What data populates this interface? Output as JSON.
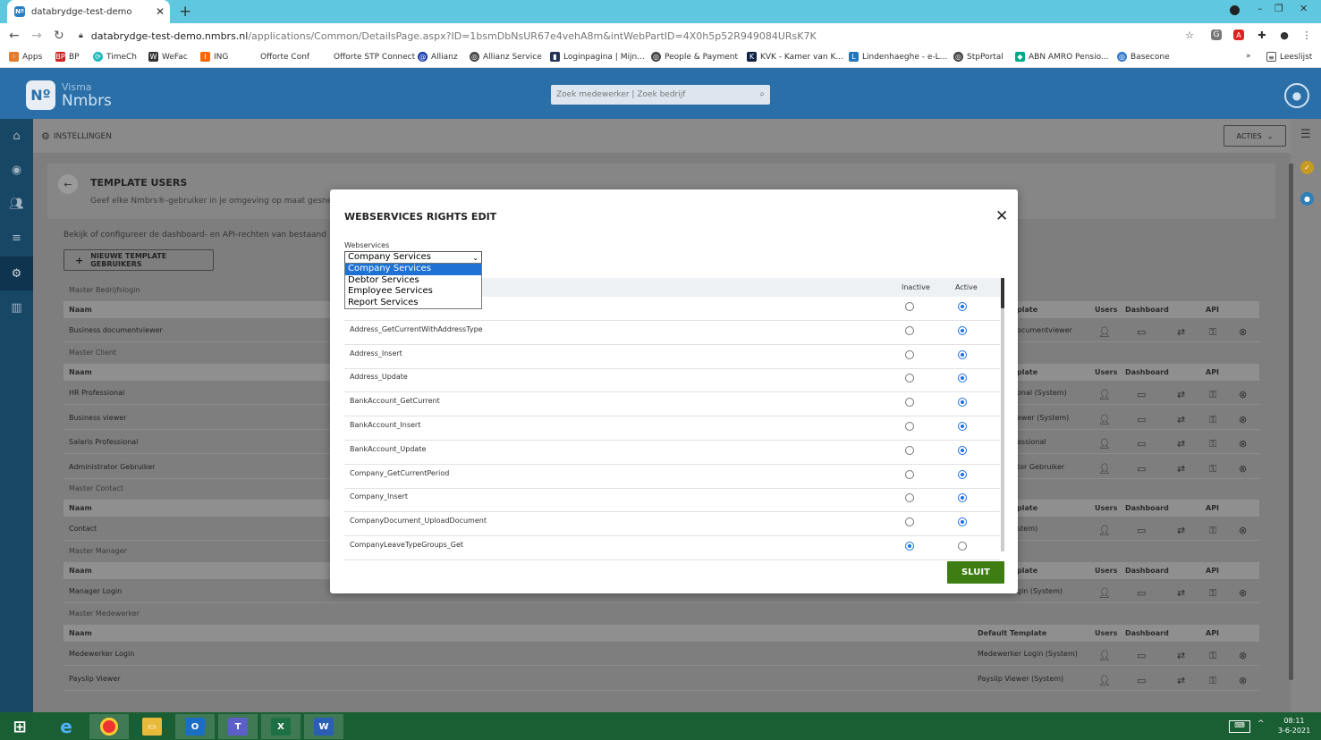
{
  "browser": {
    "tab_title": "databrydge-test-demo",
    "favicon_text": "Nº",
    "url_host": "databrydge-test-demo.nmbrs.nl",
    "url_rest": "/applications/Common/DetailsPage.aspx?ID=1bsmDbNsUR67e4vehA8m&intWebPartID=4X0h5p52R949084URsK7K",
    "bookmarks": [
      "Apps",
      "BP",
      "TimeCh",
      "WeFac",
      "ING",
      "Offorte Conf",
      "Offorte STP Connect",
      "Allianz",
      "Allianz Service",
      "Loginpagina | Mijn...",
      "People & Payment",
      "KVK - Kamer van K...",
      "Lindenhaeghe - e-L...",
      "StpPortal",
      "ABN AMRO Pensio...",
      "Basecone"
    ],
    "reading_list": "Leeslijst",
    "more_bookmarks": "»"
  },
  "app": {
    "brand_small": "Visma",
    "brand": "Nmbrs",
    "logo_text": "Nº",
    "search_placeholder": "Zoek medewerker | Zoek bedrijf",
    "settings_label": "INSTELLINGEN",
    "actions_label": "ACTIES",
    "page_title": "TEMPLATE USERS",
    "page_subtitle": "Geef elke Nmbrs®-gebruiker in je omgeving op maat gesne",
    "intro": "Bekijk of configureer de dashboard- en API-rechten van bestaand",
    "new_button": "NIEUWE TEMPLATE GEBRUIKERS",
    "col_name": "Naam",
    "col_template_partial": "plate",
    "col_template": "Default Template",
    "col_users": "Users",
    "col_dashboard": "Dashboard",
    "col_api": "API",
    "groups": [
      {
        "title": "Master Bedrijfslogin",
        "rows": [
          {
            "name": "Business documentviewer",
            "template": "ocumentviewer"
          }
        ]
      },
      {
        "title": "Master Client",
        "rows": [
          {
            "name": "HR Professional",
            "template": "onal (System)"
          },
          {
            "name": "Business viewer",
            "template": "ewer (System)"
          },
          {
            "name": "Salaris Professional",
            "template": "essional"
          },
          {
            "name": "Administrator Gebruiker",
            "template": "tor Gebruiker"
          }
        ]
      },
      {
        "title": "Master Contact",
        "rows": [
          {
            "name": "Contact",
            "template": "stem)"
          }
        ]
      },
      {
        "title": "Master Manager",
        "rows": [
          {
            "name": "Manager Login",
            "template": "gin (System)"
          }
        ]
      },
      {
        "title": "Master Medewerker",
        "rows": [
          {
            "name": "Medewerker Login",
            "template": "Medewerker Login (System)"
          },
          {
            "name": "Payslip Viewer",
            "template": "Payslip Viewer (System)"
          }
        ]
      }
    ]
  },
  "modal": {
    "title": "WEBSERVICES RIGHTS EDIT",
    "select_label": "Webservices",
    "selected": "Company Services",
    "options": [
      "Company Services",
      "Debtor Services",
      "Employee Services",
      "Report Services"
    ],
    "col_inactive": "Inactive",
    "col_active": "Active",
    "rows": [
      {
        "name": "",
        "state": "active"
      },
      {
        "name": "Address_GetCurrentWithAddressType",
        "state": "active"
      },
      {
        "name": "Address_Insert",
        "state": "active"
      },
      {
        "name": "Address_Update",
        "state": "active"
      },
      {
        "name": "BankAccount_GetCurrent",
        "state": "active"
      },
      {
        "name": "BankAccount_Insert",
        "state": "active"
      },
      {
        "name": "BankAccount_Update",
        "state": "active"
      },
      {
        "name": "Company_GetCurrentPeriod",
        "state": "active"
      },
      {
        "name": "Company_Insert",
        "state": "active"
      },
      {
        "name": "CompanyDocument_UploadDocument",
        "state": "active"
      },
      {
        "name": "CompanyLeaveTypeGroups_Get",
        "state": "inactive"
      }
    ],
    "close_button": "SLUIT"
  },
  "taskbar": {
    "time": "08:11",
    "date": "3-6-2021"
  }
}
